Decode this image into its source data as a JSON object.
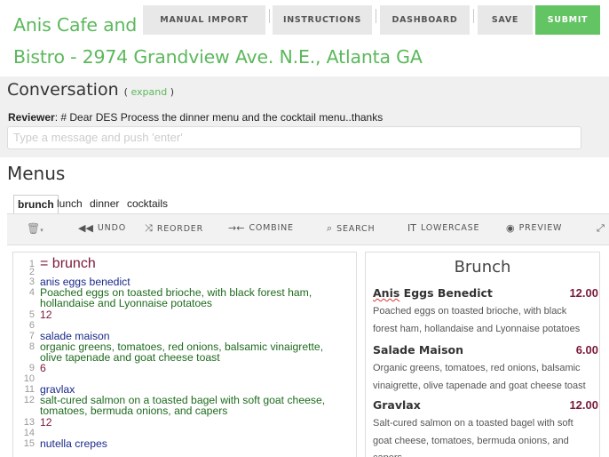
{
  "header": {
    "title_line1": "Anis Cafe and",
    "title_line2": "Bistro - 2974 Grandview Ave. N.E., Atlanta GA",
    "buttons": {
      "manual_import": "MANUAL IMPORT",
      "instructions": "INSTRUCTIONS",
      "dashboard": "DASHBOARD",
      "save": "SAVE",
      "submit": "SUBMIT"
    }
  },
  "conversation": {
    "heading": "Conversation",
    "expand_label": "expand",
    "reviewer_label": "Reviewer",
    "reviewer_message": ": # Dear DES Process the dinner menu and the cocktail menu..thanks",
    "message_placeholder": "Type a message and push 'enter'"
  },
  "menus": {
    "heading": "Menus",
    "tabs": [
      "brunch",
      "lunch",
      "dinner",
      "cocktails"
    ],
    "active_tab": "brunch"
  },
  "toolbar": {
    "undo": "UNDO",
    "reorder": "REORDER",
    "combine": "COMBINE",
    "search": "SEARCH",
    "lowercase": "LOWERCASE",
    "preview": "PREVIEW"
  },
  "editor": {
    "lines": [
      {
        "n": "1",
        "text": "= brunch"
      },
      {
        "n": "2",
        "text": ""
      },
      {
        "n": "3",
        "text": "anis eggs benedict"
      },
      {
        "n": "4",
        "text": "Poached eggs on toasted brioche, with black forest ham,"
      },
      {
        "n": "",
        "text": "hollandaise and Lyonnaise potatoes"
      },
      {
        "n": "5",
        "text": "12"
      },
      {
        "n": "6",
        "text": ""
      },
      {
        "n": "7",
        "text": "salade maison"
      },
      {
        "n": "8",
        "text": "organic greens, tomatoes, red onions, balsamic vinaigrette,"
      },
      {
        "n": "",
        "text": "olive tapenade and goat cheese toast"
      },
      {
        "n": "9",
        "text": "6"
      },
      {
        "n": "10",
        "text": ""
      },
      {
        "n": "11",
        "text": "gravlax"
      },
      {
        "n": "12",
        "text": "salt-cured salmon on a toasted bagel with soft goat cheese,"
      },
      {
        "n": "",
        "text": "tomatoes, bermuda onions, and capers"
      },
      {
        "n": "13",
        "text": "12"
      },
      {
        "n": "14",
        "text": ""
      },
      {
        "n": "15",
        "text": "nutella crepes"
      }
    ]
  },
  "preview": {
    "title": "Brunch",
    "items": [
      {
        "name": "Anis Eggs Benedict",
        "price": "12.00",
        "desc": "Poached eggs on toasted brioche, with black forest ham, hollandaise and Lyonnaise potatoes"
      },
      {
        "name": "Salade Maison",
        "price": "6.00",
        "desc": "Organic greens, tomatoes, red onions, balsamic vinaigrette, olive tapenade and goat cheese toast"
      },
      {
        "name": "Gravlax",
        "price": "12.00",
        "desc": "Salt-cured salmon on a toasted bagel with soft goat cheese, tomatoes, bermuda onions, and capers"
      }
    ]
  },
  "colors": {
    "brand_green": "#5cb85c",
    "submit_green": "#62c462",
    "price_maroon": "#7a1a3a"
  }
}
